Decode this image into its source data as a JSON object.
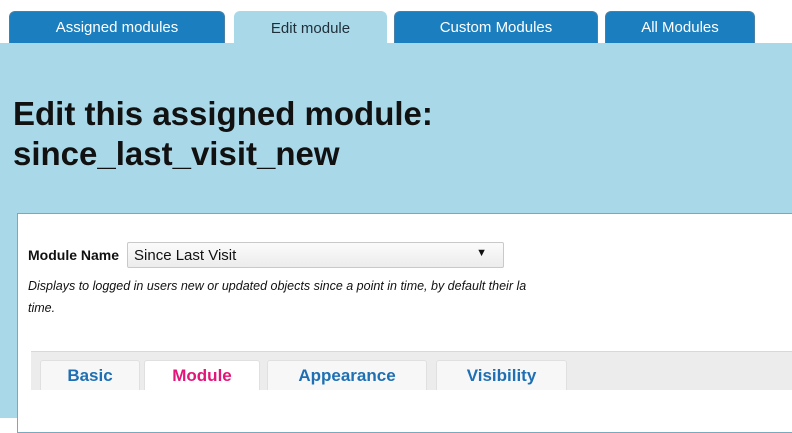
{
  "top_tabs": [
    {
      "label": "Assigned modules",
      "active": false
    },
    {
      "label": "Edit module",
      "active": true
    },
    {
      "label": "Custom Modules",
      "active": false
    },
    {
      "label": "All Modules",
      "active": false
    }
  ],
  "page": {
    "title_line1": "Edit this assigned module:",
    "title_line2": "since_last_visit_new"
  },
  "form": {
    "module_name_label": "Module Name",
    "module_select_value": "Since Last Visit",
    "description": "Displays to logged in users new or updated objects since a point in time, by default their la",
    "description_line2": "time."
  },
  "sub_tabs": [
    {
      "label": "Basic",
      "active": false
    },
    {
      "label": "Module",
      "active": true
    },
    {
      "label": "Appearance",
      "active": false
    },
    {
      "label": "Visibility",
      "active": false
    }
  ],
  "colors": {
    "panel_bg": "#a9d8e8",
    "tab_blue": "#1b7fbf",
    "active_subtab_text": "#e4157a",
    "subtab_text": "#1e6fb3"
  }
}
